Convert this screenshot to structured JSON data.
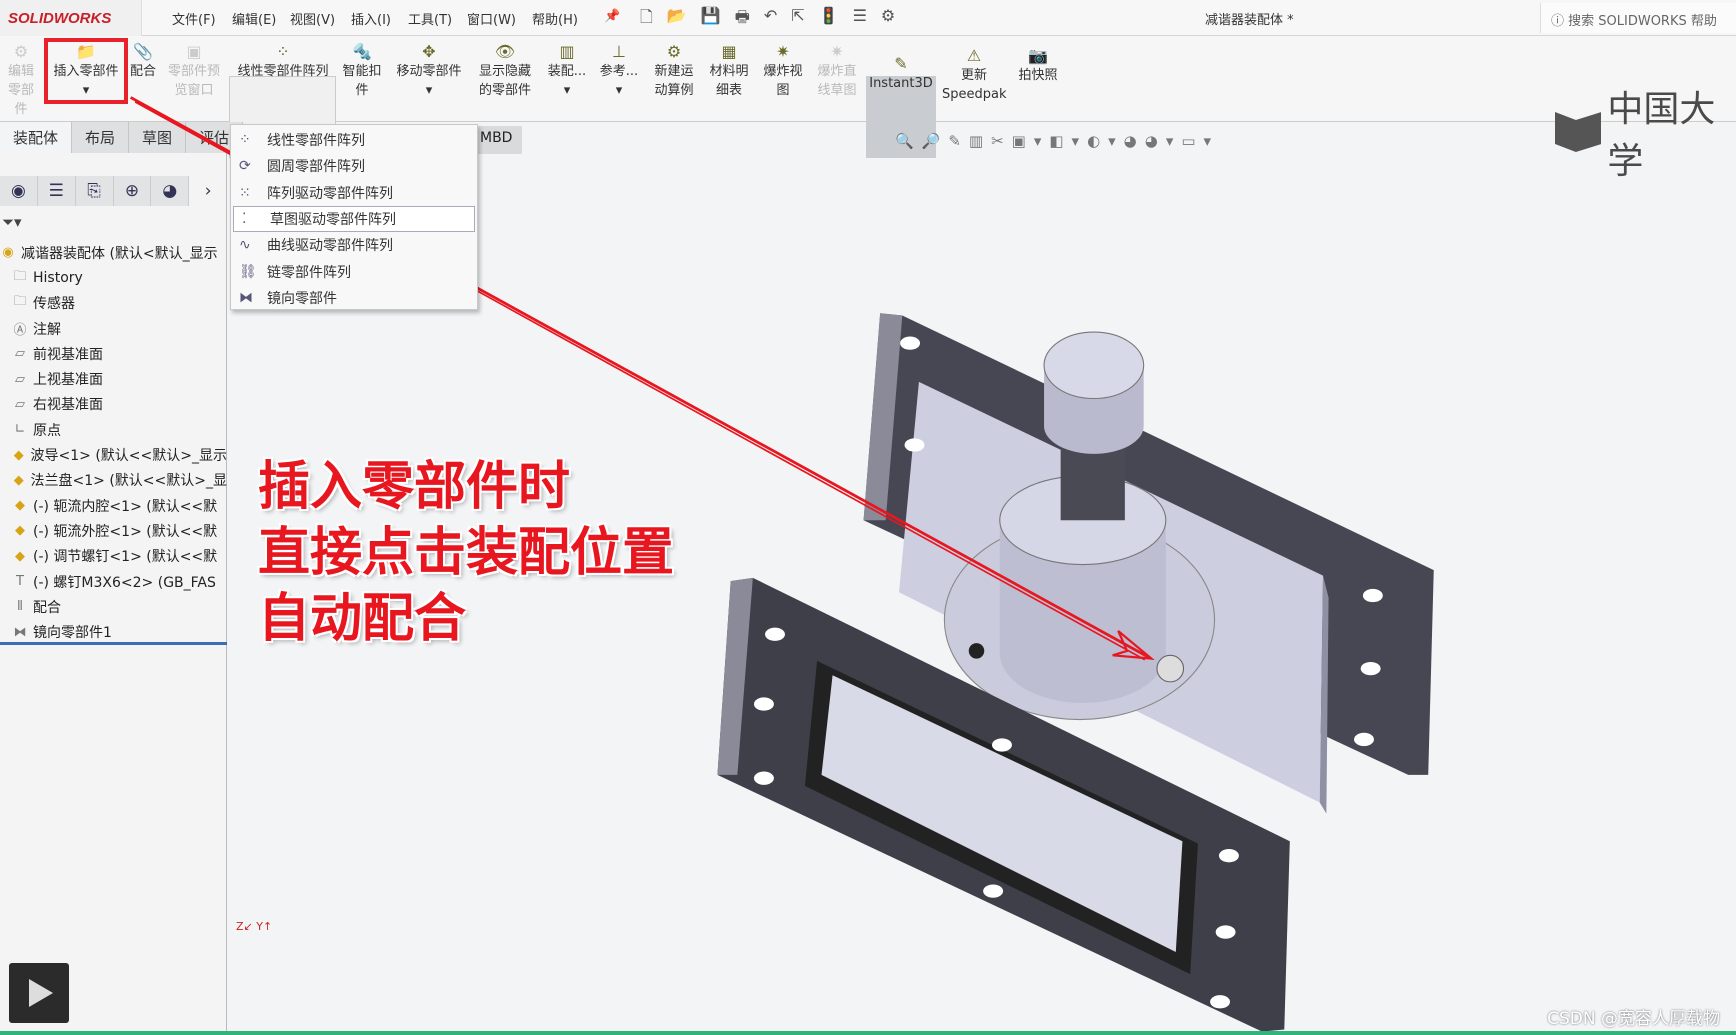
{
  "app": {
    "logo": "SOLIDWORKS",
    "document_title": "减谐器装配体 *",
    "search_placeholder": "搜索 SOLIDWORKS 帮助",
    "brand": "中国大学"
  },
  "menu": [
    "文件(F)",
    "编辑(E)",
    "视图(V)",
    "插入(I)",
    "工具(T)",
    "窗口(W)",
    "帮助(H)"
  ],
  "ribbon": [
    {
      "label": "编辑零部件",
      "enabled": false,
      "icon": "edit-component-icon"
    },
    {
      "label": "插入零部件",
      "enabled": true,
      "icon": "insert-component-icon",
      "highlighted": true
    },
    {
      "label": "配合",
      "enabled": true,
      "icon": "mate-icon"
    },
    {
      "label": "零部件预览窗口",
      "enabled": false,
      "icon": "preview-window-icon"
    },
    {
      "label": "线性零部件阵列",
      "enabled": true,
      "icon": "linear-pattern-icon"
    },
    {
      "label": "智能扣件",
      "enabled": true,
      "icon": "smart-fastener-icon"
    },
    {
      "label": "移动零部件",
      "enabled": true,
      "icon": "move-component-icon"
    },
    {
      "label": "显示隐藏的零部件",
      "enabled": true,
      "icon": "show-hidden-icon"
    },
    {
      "label": "装配...",
      "enabled": true,
      "icon": "assembly-features-icon"
    },
    {
      "label": "参考...",
      "enabled": true,
      "icon": "reference-geometry-icon"
    },
    {
      "label": "新建运动算例",
      "enabled": true,
      "icon": "motion-study-icon"
    },
    {
      "label": "材料明细表",
      "enabled": true,
      "icon": "bom-icon"
    },
    {
      "label": "爆炸视图",
      "enabled": true,
      "icon": "exploded-view-icon"
    },
    {
      "label": "爆炸直线草图",
      "enabled": false,
      "icon": "explode-line-icon"
    },
    {
      "label": "Instant3D",
      "enabled": true,
      "icon": "instant3d-icon",
      "active": true
    },
    {
      "label": "更新 Speedpak",
      "enabled": true,
      "icon": "speedpak-icon"
    },
    {
      "label": "拍快照",
      "enabled": true,
      "icon": "snapshot-icon"
    }
  ],
  "tabs": [
    "装配体",
    "布局",
    "草图",
    "评估"
  ],
  "mbd_tab": "MBD",
  "pattern_menu": [
    {
      "label": "线性零部件阵列"
    },
    {
      "label": "圆周零部件阵列"
    },
    {
      "label": "阵列驱动零部件阵列"
    },
    {
      "label": "草图驱动零部件阵列",
      "hovered": true
    },
    {
      "label": "曲线驱动零部件阵列"
    },
    {
      "label": "链零部件阵列"
    },
    {
      "label": "镜向零部件"
    }
  ],
  "tree": [
    {
      "label": "减谐器装配体 (默认<默认_显示",
      "icon": "assembly-icon"
    },
    {
      "label": "History",
      "icon": "history-icon"
    },
    {
      "label": "传感器",
      "icon": "sensor-icon"
    },
    {
      "label": "注解",
      "icon": "annotation-icon"
    },
    {
      "label": "前视基准面",
      "icon": "plane-icon"
    },
    {
      "label": "上视基准面",
      "icon": "plane-icon"
    },
    {
      "label": "右视基准面",
      "icon": "plane-icon"
    },
    {
      "label": "原点",
      "icon": "origin-icon"
    },
    {
      "label": "波导<1> (默认<<默认>_显示",
      "icon": "part-icon"
    },
    {
      "label": "法兰盘<1> (默认<<默认>_显",
      "icon": "part-icon"
    },
    {
      "label": "(-) 轭流内腔<1> (默认<<默",
      "icon": "part-icon"
    },
    {
      "label": "(-) 轭流外腔<1> (默认<<默",
      "icon": "part-icon"
    },
    {
      "label": "(-) 调节螺钉<1> (默认<<默",
      "icon": "part-icon"
    },
    {
      "label": "(-) 螺钉M3X6<2> (GB_FAS",
      "icon": "screw-icon"
    },
    {
      "label": "配合",
      "icon": "mates-icon"
    },
    {
      "label": "镜向零部件1",
      "icon": "mirror-icon"
    }
  ],
  "annotation": [
    "插入零部件时",
    "直接点击装配位置",
    "自动配合"
  ],
  "watermark": "CSDN @宽容人厚载物",
  "colors": {
    "annotation": "#e8161f",
    "model_dark": "#43434f",
    "model_light": "#cfd0e2"
  }
}
